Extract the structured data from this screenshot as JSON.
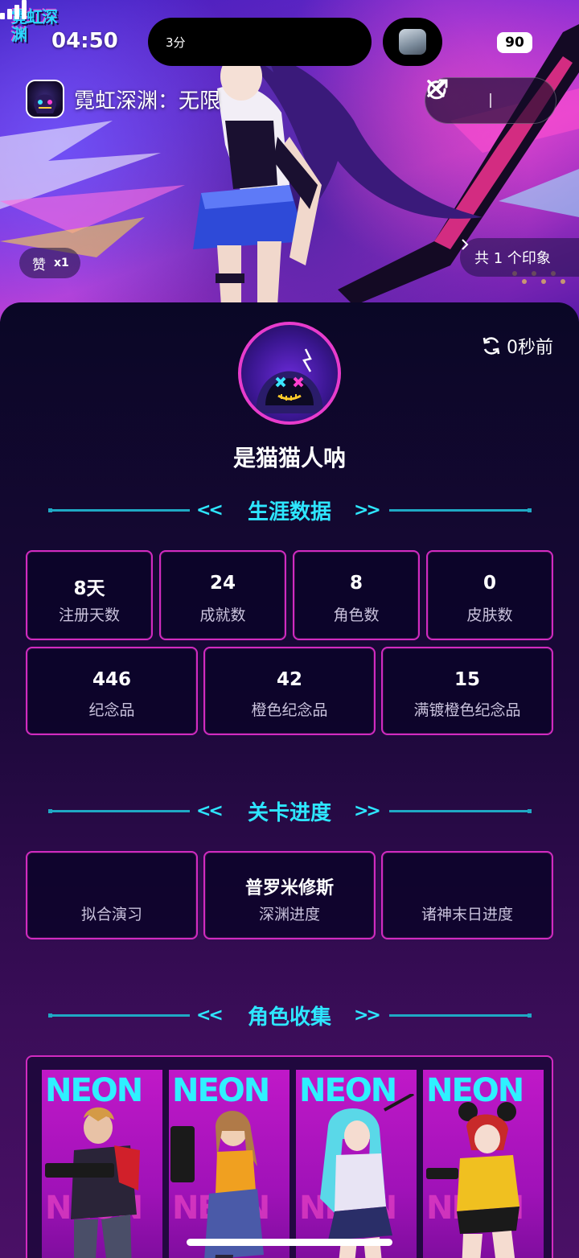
{
  "status_bar": {
    "time": "04:50",
    "island_label": "3分",
    "battery": "90"
  },
  "game_logo": "霓虹深渊",
  "mini_program": {
    "title": "霓虹深渊：无限",
    "share_icon": "share-icon",
    "close_icon": "close-icon"
  },
  "banner": {
    "like_label": "赞",
    "like_count": "x1",
    "impressions": "共 1 个印象"
  },
  "profile": {
    "refresh_text": "0秒前",
    "username": "是猫猫人呐"
  },
  "career": {
    "title": "生涯数据",
    "row1": [
      {
        "value": "8天",
        "label": "注册天数"
      },
      {
        "value": "24",
        "label": "成就数"
      },
      {
        "value": "8",
        "label": "角色数"
      },
      {
        "value": "0",
        "label": "皮肤数"
      }
    ],
    "row2": [
      {
        "value": "446",
        "label": "纪念品"
      },
      {
        "value": "42",
        "label": "橙色纪念品"
      },
      {
        "value": "15",
        "label": "满镀橙色纪念品"
      }
    ]
  },
  "progress": {
    "title": "关卡进度",
    "items": [
      {
        "value": "",
        "label": "拟合演习"
      },
      {
        "value": "普罗米修斯",
        "label": "深渊进度"
      },
      {
        "value": "",
        "label": "诸神末日进度"
      }
    ]
  },
  "collection": {
    "title": "角色收集",
    "card_text": "NEON",
    "characters": [
      "char-1",
      "char-2",
      "char-3",
      "char-4"
    ]
  },
  "colors": {
    "accent_cyan": "#2ee6ff",
    "card_border": "#d12bc0",
    "panel_bg": "#0a0726"
  }
}
